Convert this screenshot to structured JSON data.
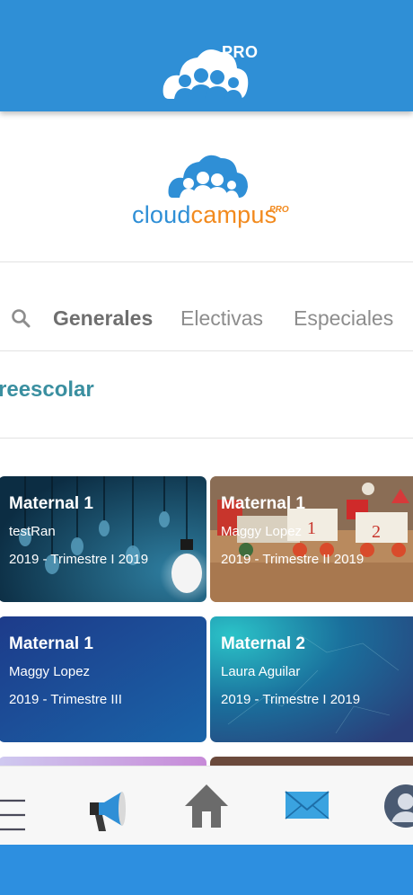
{
  "header": {
    "logo_icon": "cloud-people-icon",
    "badge": "PRO"
  },
  "brand": {
    "logo_icon": "cloud-people-icon",
    "word_part1": "cloud",
    "word_part2": "campus",
    "badge": "PRO",
    "colors": {
      "blue": "#2f8fd6",
      "orange": "#f28a1e"
    }
  },
  "tabs": {
    "search_icon": "search-icon",
    "items": [
      {
        "label": "Generales",
        "active": true
      },
      {
        "label": "Electivas",
        "active": false
      },
      {
        "label": "Especiales",
        "active": false
      }
    ]
  },
  "section": {
    "title": "reescolar"
  },
  "courses": [
    {
      "title": "Maternal 1",
      "teacher": "testRan",
      "period": "2019 - Trimestre I 2019",
      "theme": "light-bulbs"
    },
    {
      "title": "Maternal 1",
      "teacher": "Maggy Lopez",
      "period": "2019 - Trimestre II 2019",
      "theme": "toy-train"
    },
    {
      "title": "Maternal 1",
      "teacher": "Maggy Lopez",
      "period": "2019 - Trimestre III",
      "theme": "blue-gradient"
    },
    {
      "title": "Maternal 2",
      "teacher": "Laura Aguilar",
      "period": "2019 - Trimestre I 2019",
      "theme": "teal-texture"
    }
  ],
  "bottom_nav": [
    {
      "name": "menu",
      "icon": "hamburger-menu-icon"
    },
    {
      "name": "announcements",
      "icon": "megaphone-icon"
    },
    {
      "name": "home",
      "icon": "home-icon"
    },
    {
      "name": "messages",
      "icon": "envelope-icon"
    },
    {
      "name": "profile",
      "icon": "avatar-icon"
    }
  ]
}
